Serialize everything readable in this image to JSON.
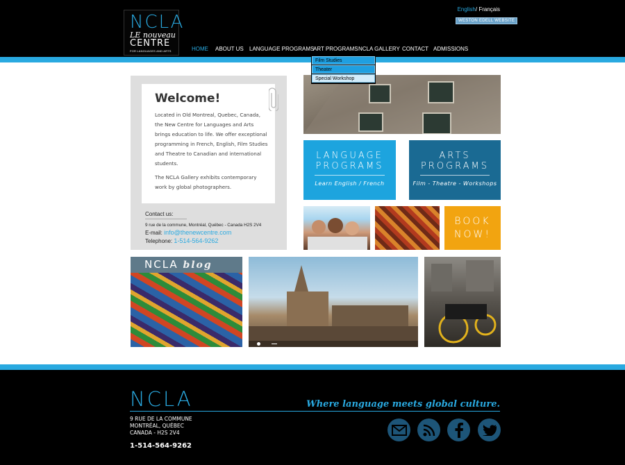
{
  "logo": {
    "name": "NCLA",
    "le": "LE",
    "nouveau": "nouveau",
    "centre": "CENTRE",
    "sub": "FOR LANGUAGES AND ARTS"
  },
  "language": {
    "english": "English",
    "sep": "/",
    "french": "Français"
  },
  "weston_link": "WESTON EDELL WEBSITE",
  "nav": [
    "HOME",
    "ABOUT US",
    "LANGUAGE PROGRAMS",
    "ART PROGRAMS",
    "NCLA GALLERY",
    "CONTACT",
    "ADMISSIONS"
  ],
  "dropdown": [
    "Film Studies",
    "Theater",
    "Special Workshop"
  ],
  "welcome": {
    "title": "Welcome!",
    "p1": "Located in Old Montreal, Quebec, Canada, the New Centre for Languages and Arts brings education to life. We offer exceptional programming in French, English, Film Studies and Theatre to Canadian and international students.",
    "p2": "The NCLA Gallery exhibits contemporary work by global photographers."
  },
  "contact": {
    "title": "Contact us:",
    "address": "9 rue de la commune, Montréal, Québec - Canada   H2S 2V4",
    "email_label": "E-mail:",
    "email": "info@thenewcentre.com",
    "phone_label": "Telephone:",
    "phone": "1-514-564-9262"
  },
  "tiles": {
    "language": {
      "line1": "LANGUAGE",
      "line2": "PROGRAMS",
      "sub": "Learn English / French"
    },
    "arts": {
      "line1": "ARTS",
      "line2": "PROGRAMS",
      "sub": "Film - Theatre - Workshops"
    },
    "book": {
      "line1": "BOOK",
      "line2": "NOW!"
    }
  },
  "blog": {
    "ncla": "NCLA",
    "blog": "blog"
  },
  "footer": {
    "logo": "NCLA",
    "tagline": "Where language meets global culture.",
    "addr1": "9 RUE DE LA COMMUNE",
    "addr2": "MONTRÉAL, QUÉBEC",
    "addr3": "CANADA -  H2S 2V4",
    "phone": "1-514-564-9262"
  },
  "social": [
    "mail-icon",
    "rss-icon",
    "facebook-icon",
    "twitter-icon"
  ],
  "colors": {
    "accent": "#29a9e0",
    "dark_blue": "#1a6a93",
    "orange": "#f2a410"
  }
}
